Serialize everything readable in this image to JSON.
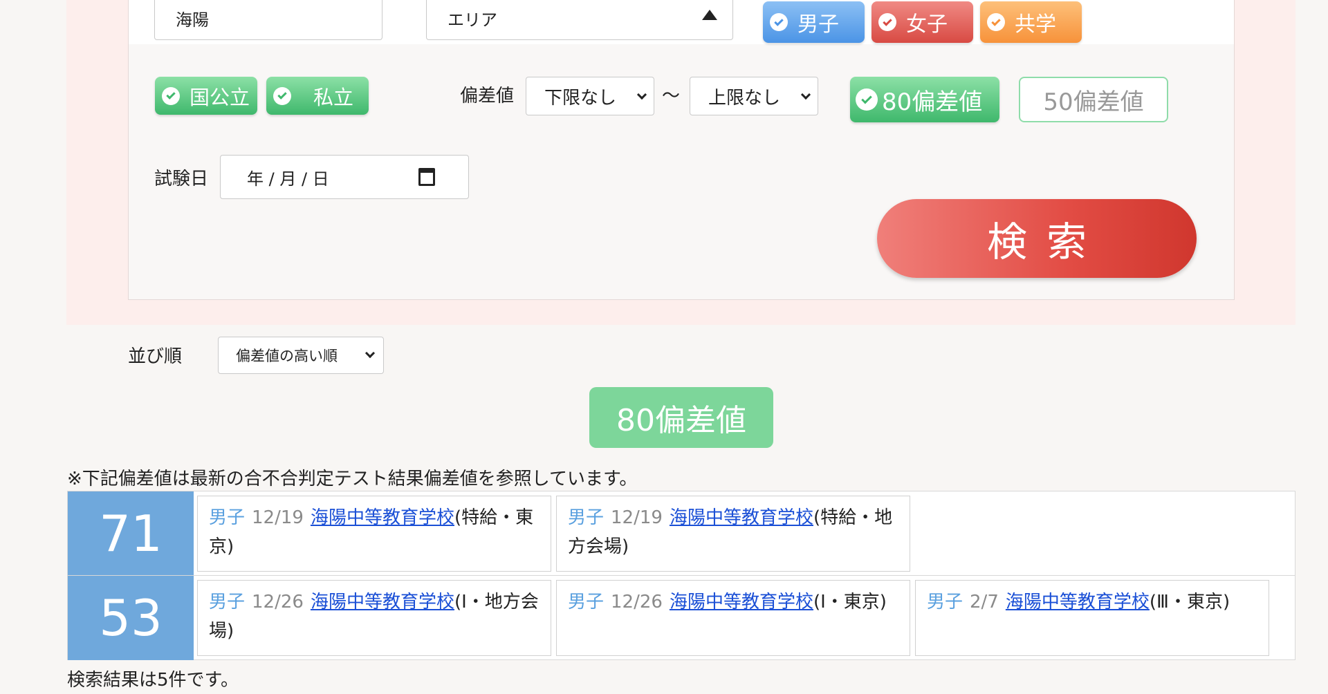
{
  "search": {
    "keyword_value": "海陽",
    "area_value": "エリア",
    "gender_tags": [
      "男子",
      "女子",
      "共学"
    ],
    "type_tags": [
      "国公立",
      "私立"
    ],
    "deviation_label": "偏差値",
    "deviation_low": "下限なし",
    "deviation_tilde": "〜",
    "deviation_high": "上限なし",
    "deviation_80": "80偏差値",
    "deviation_50": "50偏差値",
    "exam_date_label": "試験日",
    "exam_date_value": "年 / 月 / 日",
    "search_button": "検索"
  },
  "results": {
    "sort_label": "並び順",
    "sort_value": "偏差値の高い順",
    "badge": "80偏差値",
    "note": "※下記偏差値は最新の合不合判定テスト結果偏差値を参照しています。",
    "rows": [
      {
        "score": "71",
        "cells": [
          {
            "gender": "男子",
            "date": "12/19",
            "school": "海陽中等教育学校",
            "detail": "(特給・東京)"
          },
          {
            "gender": "男子",
            "date": "12/19",
            "school": "海陽中等教育学校",
            "detail": "(特給・地方会場)"
          }
        ]
      },
      {
        "score": "53",
        "cells": [
          {
            "gender": "男子",
            "date": "12/26",
            "school": "海陽中等教育学校",
            "detail": "(Ⅰ・地方会場)"
          },
          {
            "gender": "男子",
            "date": "12/26",
            "school": "海陽中等教育学校",
            "detail": "(Ⅰ・東京)"
          },
          {
            "gender": "男子",
            "date": "2/7",
            "school": "海陽中等教育学校",
            "detail": "(Ⅲ・東京)"
          }
        ]
      }
    ],
    "count_text": "検索結果は5件です。"
  }
}
